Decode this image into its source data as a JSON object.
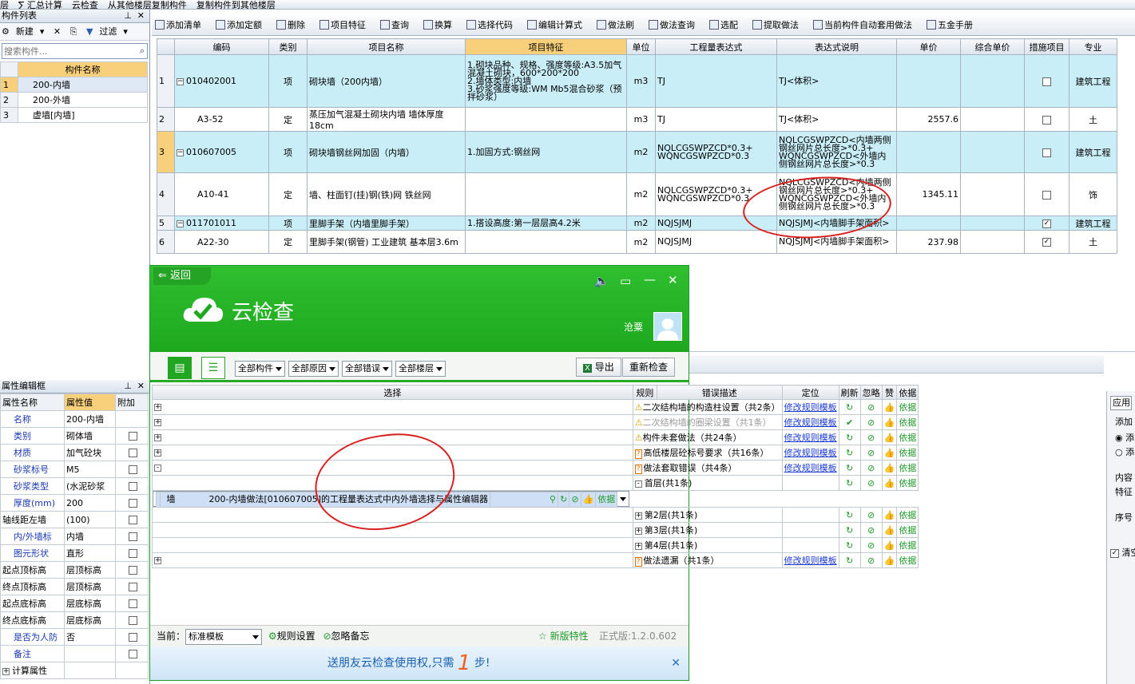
{
  "topbar": {
    "items": [
      "层",
      "∑ 汇总计算",
      "云检查",
      "从其他楼层复制构件",
      "复制构件到其他楼层"
    ]
  },
  "left_panel": {
    "title": "构件列表",
    "new_label": "新建",
    "filter_label": "过滤",
    "search_placeholder": "搜索构件...",
    "col_header": "构件名称",
    "rows": [
      {
        "no": "1",
        "name": "200-内墙"
      },
      {
        "no": "2",
        "name": "200-外墙"
      },
      {
        "no": "3",
        "name": "虚墙[内墙]"
      }
    ]
  },
  "main_toolbar": {
    "items": [
      "添加清单",
      "添加定额",
      "删除",
      "项目特征",
      "查询",
      "换算",
      "选择代码",
      "编辑计算式",
      "做法刷",
      "做法查询",
      "选配",
      "提取做法",
      "当前构件自动套用做法",
      "五金手册"
    ]
  },
  "grid": {
    "headers": [
      "编码",
      "类别",
      "项目名称",
      "项目特征",
      "单位",
      "工程量表达式",
      "表达式说明",
      "单价",
      "综合单价",
      "措施项目",
      "专业"
    ],
    "rows": [
      {
        "no": "1",
        "code": "010402001",
        "type": "项",
        "name": "砌块墙（200内墙）",
        "feature": "1.砌块品种、规格、强度等级:A3.5加气混凝土砌块，600*200*200\n2.墙体类型:内墙\n3.砂浆强度等级:WM Mb5混合砂浆（预拌砂浆）",
        "unit": "m3",
        "expr": "TJ",
        "desc": "TJ<体积>",
        "price": "",
        "cprice": "",
        "measure": false,
        "major": "建筑工程"
      },
      {
        "no": "2",
        "code": "A3-52",
        "type": "定",
        "name": "蒸压加气混凝土砌块内墙 墙体厚度18cm",
        "feature": "",
        "unit": "m3",
        "expr": "TJ",
        "desc": "TJ<体积>",
        "price": "2557.6",
        "cprice": "",
        "measure": false,
        "major": "土"
      },
      {
        "no": "3",
        "code": "010607005",
        "type": "项",
        "name": "砌块墙钢丝网加固（内墙）",
        "feature": "1.加固方式:钢丝网",
        "unit": "m2",
        "expr": "NQLCGSWPZCD*0.3+\nWQNCGSWPZCD*0.3",
        "desc": "NQLCGSWPZCD<内墙两侧钢丝网片总长度>*0.3+\nWQNCGSWPZCD<外墙内侧钢丝网片总长度>*0.3",
        "price": "",
        "cprice": "",
        "measure": false,
        "major": "建筑工程"
      },
      {
        "no": "4",
        "code": "A10-41",
        "type": "定",
        "name": "墙、柱面钉(挂)钢(铁)网 铁丝网",
        "feature": "",
        "unit": "m2",
        "expr": "NQLCGSWPZCD*0.3+\nWQNCGSWPZCD*0.3",
        "desc": "NQLCGSWPZCD<内墙两侧钢丝网片总长度>*0.3+\nWQNCGSWPZCD<外墙内侧钢丝网片总长度>*0.3",
        "price": "1345.11",
        "cprice": "",
        "measure": false,
        "major": "饰"
      },
      {
        "no": "5",
        "code": "011701011",
        "type": "项",
        "name": "里脚手架（内墙里脚手架）",
        "feature": "1.搭设高度:第一层层高4.2米",
        "unit": "m2",
        "expr": "NQJSJMJ",
        "desc": "NQJSJMJ<内墙脚手架面积>",
        "price": "",
        "cprice": "",
        "measure": true,
        "major": "建筑工程"
      },
      {
        "no": "6",
        "code": "A22-30",
        "type": "定",
        "name": "里脚手架(钢管) 工业建筑 基本层3.6m",
        "feature": "",
        "unit": "m2",
        "expr": "NQJSJMJ",
        "desc": "NQJSJMJ<内墙脚手架面积>",
        "price": "237.98",
        "cprice": "",
        "measure": true,
        "major": "土"
      }
    ]
  },
  "props": {
    "title": "属性编辑框",
    "headers": [
      "属性名称",
      "属性值",
      "附加"
    ],
    "rows": [
      {
        "name": "名称",
        "value": "200-内墙",
        "blue": true,
        "chk": false
      },
      {
        "name": "类别",
        "value": "砌体墙",
        "blue": true,
        "chk": true
      },
      {
        "name": "材质",
        "value": "加气砼块",
        "blue": true,
        "chk": true
      },
      {
        "name": "砂浆标号",
        "value": "M5",
        "blue": true,
        "chk": true
      },
      {
        "name": "砂浆类型",
        "value": "(水泥砂浆",
        "blue": true,
        "chk": true
      },
      {
        "name": "厚度(mm)",
        "value": "200",
        "blue": true,
        "chk": true
      },
      {
        "name": "轴线距左墙",
        "value": "(100)",
        "blue": false,
        "chk": true
      },
      {
        "name": "内/外墙标",
        "value": "内墙",
        "blue": true,
        "chk": true
      },
      {
        "name": "图元形状",
        "value": "直形",
        "blue": true,
        "chk": true
      },
      {
        "name": "起点顶标高",
        "value": "层顶标高",
        "blue": false,
        "chk": true
      },
      {
        "name": "终点顶标高",
        "value": "层顶标高",
        "blue": false,
        "chk": true
      },
      {
        "name": "起点底标高",
        "value": "层底标高",
        "blue": false,
        "chk": true
      },
      {
        "name": "终点底标高",
        "value": "层底标高",
        "blue": false,
        "chk": true
      },
      {
        "name": "是否为人防",
        "value": "否",
        "blue": true,
        "chk": true
      },
      {
        "name": "备注",
        "value": "",
        "blue": true,
        "chk": true
      },
      {
        "name": "计算属性",
        "value": "",
        "blue": false,
        "chk": false
      }
    ]
  },
  "right_panel": {
    "apply": "应用",
    "label1": "添加",
    "radio1": "添",
    "radio2": "添",
    "label2": "内容",
    "label3": "特征",
    "label4": "序号",
    "check": "清空"
  },
  "dialog": {
    "back": "返回",
    "title": "云检查",
    "user": "沧粟",
    "filters": [
      "全部构件",
      "全部原因",
      "全部错误",
      "全部楼层"
    ],
    "export": "导出",
    "recheck": "重新检查",
    "headers": [
      "选择",
      "规则",
      "错误描述",
      "定位",
      "刷新",
      "忽略",
      "赞",
      "依据"
    ],
    "rows": [
      {
        "expander": "+",
        "icon": "warn",
        "text": "二次结构墙的构造柱设置（共2条）",
        "link": "修改规则模板",
        "gray": false,
        "indent": 0,
        "check": false
      },
      {
        "expander": "+",
        "icon": "warn",
        "text": "二次结构墙的圈梁设置（共1条）",
        "link": "修改规则模板",
        "gray": true,
        "indent": 0,
        "check": true
      },
      {
        "expander": "+",
        "icon": "warn",
        "text": "构件未套做法（共24条）",
        "link": "修改规则模板",
        "gray": false,
        "indent": 0,
        "check": false
      },
      {
        "expander": "+",
        "icon": "q",
        "text": "高低楼层砼标号要求（共16条）",
        "link": "修改规则模板",
        "gray": false,
        "indent": 0,
        "check": false
      },
      {
        "expander": "-",
        "icon": "q",
        "text": "做法套取错误（共4条）",
        "link": "修改规则模板",
        "gray": false,
        "indent": 0,
        "check": false
      },
      {
        "expander": "-",
        "icon": "",
        "text": "首层(共1条)",
        "link": "",
        "gray": false,
        "indent": 1,
        "check": false
      },
      {
        "expander": "",
        "icon": "",
        "text": "墙",
        "desc": "200-内墙做法[010607005]的工程量表达式中内外墙选择与属性编辑器",
        "link": "",
        "gray": false,
        "indent": 2,
        "check": false,
        "selected": true
      },
      {
        "expander": "+",
        "icon": "",
        "text": "第2层(共1条)",
        "link": "",
        "gray": false,
        "indent": 1,
        "check": false
      },
      {
        "expander": "+",
        "icon": "",
        "text": "第3层(共1条)",
        "link": "",
        "gray": false,
        "indent": 1,
        "check": false
      },
      {
        "expander": "+",
        "icon": "",
        "text": "第4层(共1条)",
        "link": "",
        "gray": false,
        "indent": 1,
        "check": false
      },
      {
        "expander": "+",
        "icon": "q",
        "text": "做法遗漏（共1条）",
        "link": "修改规则模板",
        "gray": false,
        "indent": 0,
        "check": false
      }
    ],
    "basis": "依据",
    "footer": {
      "current_label": "当前：",
      "template": "标准模板",
      "rule_settings": "规则设置",
      "ignore_memo": "忽略备忘",
      "new_feature": "新版特性",
      "version": "正式版:1.2.0.602"
    },
    "banner": {
      "pre": "送朋友云检查使用权,只需",
      "num": "1",
      "post": "步!"
    }
  }
}
